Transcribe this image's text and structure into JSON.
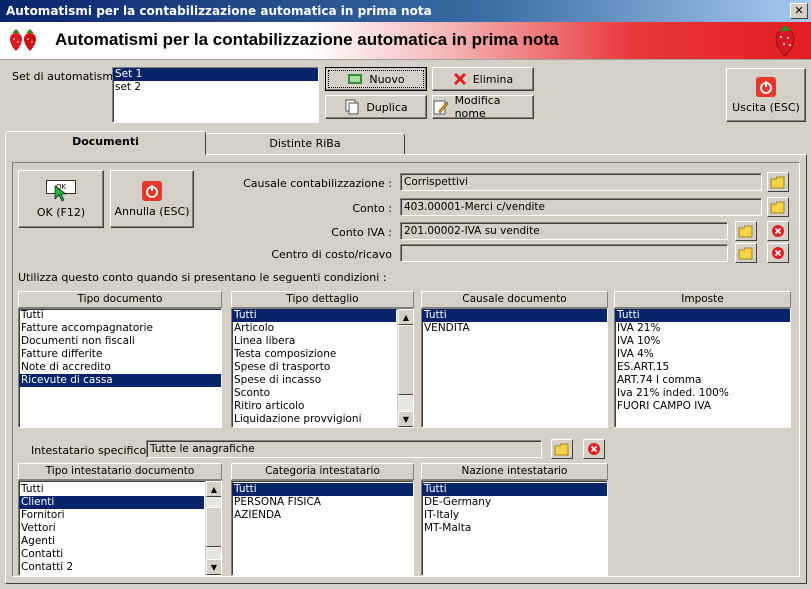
{
  "window": {
    "title": "Automatismi per la contabilizzazione automatica in prima nota",
    "close_glyph": "✕"
  },
  "banner": {
    "title": "Automatismi per la contabilizzazione automatica in prima nota"
  },
  "set": {
    "label": "Set di automatismi :",
    "items": [
      "Set 1",
      "set 2"
    ],
    "selected_index": 0
  },
  "toolbar": {
    "nuovo_label": "Nuovo",
    "elimina_label": "Elimina",
    "duplica_label": "Duplica",
    "modifica_label": "Modifica nome",
    "uscita_label": "Uscita (ESC)"
  },
  "tabs": [
    {
      "label": "Documenti",
      "active": true
    },
    {
      "label": "Distinte RiBa",
      "active": false
    }
  ],
  "actions": {
    "ok_label": "OK (F12)",
    "ok_icon_text": "OK",
    "annulla_label": "Annulla (ESC)"
  },
  "fields": {
    "causale": {
      "label": "Causale contabilizzazione :",
      "value": "Corrispettivi"
    },
    "conto": {
      "label": "Conto :",
      "value": "403.00001-Merci c/vendite"
    },
    "conto_iva": {
      "label": "Conto IVA :",
      "value": "201.00002-IVA su vendite"
    },
    "centro": {
      "label": "Centro di costo/ricavo",
      "value": ""
    }
  },
  "conditions_label": "Utilizza questo conto quando si presentano le seguenti condizioni :",
  "lists": {
    "tipo_documento": {
      "header": "Tipo documento",
      "items": [
        "Tutti",
        "Fatture accompagnatorie",
        "Documenti non fiscali",
        "Fatture differite",
        "Note di accredito",
        "Ricevute di cassa"
      ],
      "selected_index": 5
    },
    "tipo_dettaglio": {
      "header": "Tipo dettaglio",
      "items": [
        "Tutti",
        "Articolo",
        "Linea libera",
        "Testa composizione",
        "Spese di trasporto",
        "Spese di incasso",
        "Sconto",
        "Ritiro articolo",
        "Liquidazione provvigioni"
      ],
      "selected_index": 0
    },
    "causale_documento": {
      "header": "Causale documento",
      "items": [
        "Tutti",
        "VENDITA"
      ],
      "selected_index": 0
    },
    "imposte": {
      "header": "Imposte",
      "items": [
        "Tutti",
        "IVA 21%",
        "IVA 10%",
        "IVA 4%",
        "ES.ART.15",
        "ART.74 I comma",
        "Iva 21% inded. 100%",
        "FUORI CAMPO IVA"
      ],
      "selected_index": 0
    },
    "tipo_intestatario": {
      "header": "Tipo intestatario documento",
      "items": [
        "Tutti",
        "Clienti",
        "Fornitori",
        "Vettori",
        "Agenti",
        "Contatti",
        "Contatti 2"
      ],
      "selected_index": 1
    },
    "categoria_intestatario": {
      "header": "Categoria intestatario",
      "items": [
        "Tutti",
        "PERSONA FISICA",
        "AZIENDA"
      ],
      "selected_index": 0
    },
    "nazione_intestatario": {
      "header": "Nazione intestatario",
      "items": [
        "Tutti",
        "DE-Germany",
        "IT-Italy",
        "MT-Malta"
      ],
      "selected_index": 0
    }
  },
  "intestatario": {
    "label": "Intestatario specifico :",
    "value": "Tutte le anagrafiche"
  },
  "colors": {
    "selection": "#0a246a",
    "face": "#d4d0c8",
    "banner_red": "#e21d23"
  }
}
